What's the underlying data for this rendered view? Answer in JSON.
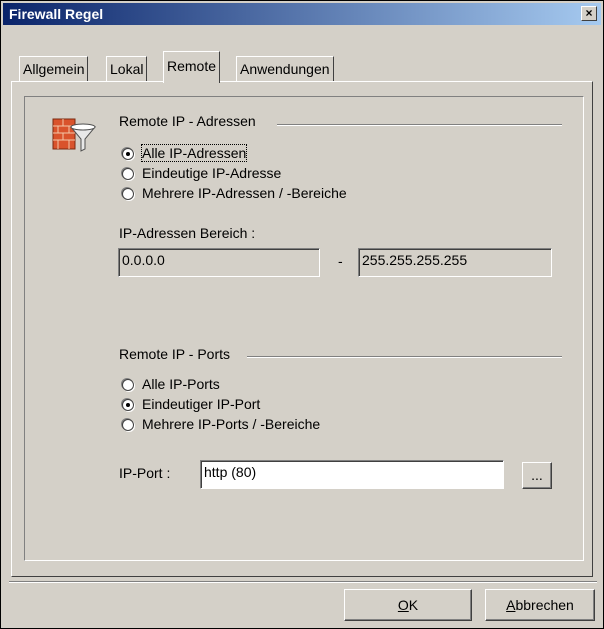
{
  "window": {
    "title": "Firewall Regel",
    "close_glyph": "×"
  },
  "tabs": [
    {
      "label": "Allgemein"
    },
    {
      "label": "Lokal"
    },
    {
      "label": "Remote",
      "active": true
    },
    {
      "label": "Anwendungen"
    }
  ],
  "icon": "firewall-filter-icon",
  "remote_ip": {
    "group_label": "Remote IP - Adressen",
    "options": [
      {
        "label": "Alle IP-Adressen",
        "selected": true
      },
      {
        "label": "Eindeutige IP-Adresse",
        "selected": false
      },
      {
        "label": "Mehrere IP-Adressen / -Bereiche",
        "selected": false
      }
    ],
    "range_label": "IP-Adressen Bereich :",
    "range_from": "0.0.0.0",
    "range_separator": "-",
    "range_to": "255.255.255.255"
  },
  "remote_ports": {
    "group_label": "Remote IP - Ports",
    "options": [
      {
        "label": "Alle IP-Ports",
        "selected": false
      },
      {
        "label": "Eindeutiger IP-Port",
        "selected": true
      },
      {
        "label": "Mehrere IP-Ports / -Bereiche",
        "selected": false
      }
    ],
    "port_label": "IP-Port :",
    "port_value": "http (80)",
    "browse_label": "..."
  },
  "buttons": {
    "ok_mnemonic": "O",
    "ok_rest": "K",
    "cancel_mnemonic": "A",
    "cancel_rest": "bbrechen"
  },
  "colors": {
    "face": "#d4d0c8",
    "title_start": "#0a246a",
    "title_end": "#a6caf0"
  }
}
